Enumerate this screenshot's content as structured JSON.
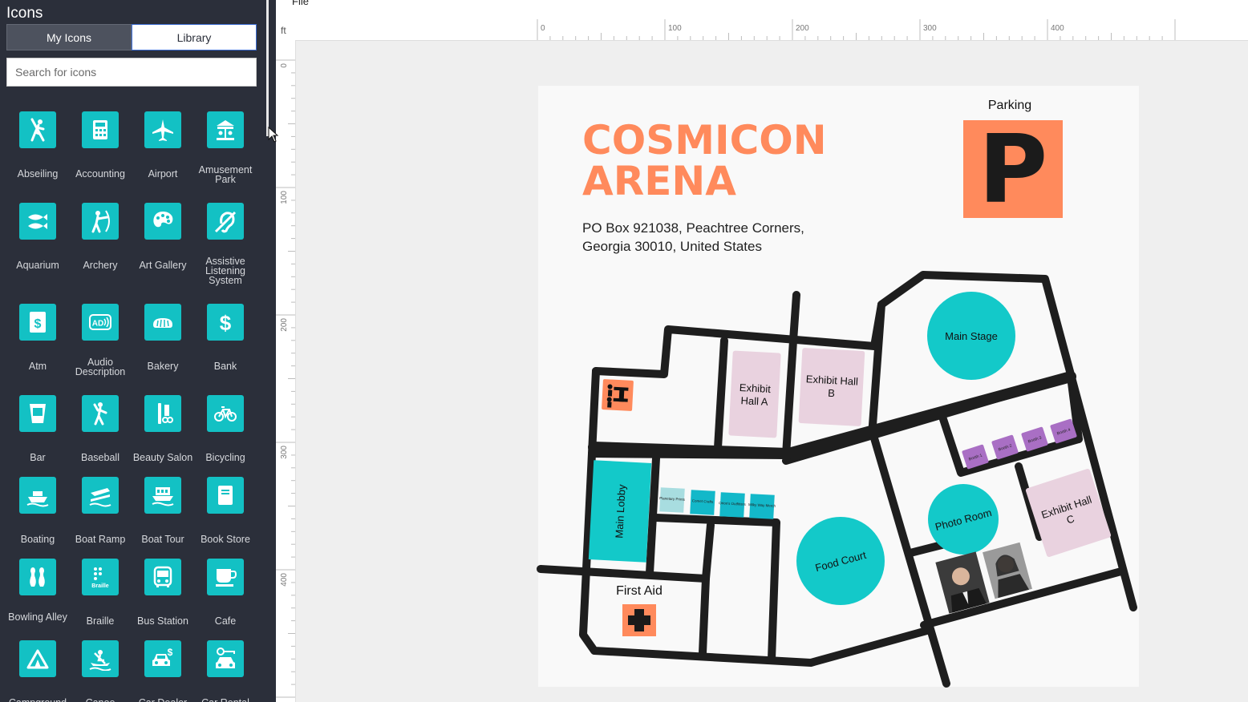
{
  "sidebar": {
    "title": "Icons",
    "tabs": {
      "my_icons": "My Icons",
      "library": "Library"
    },
    "search_placeholder": "Search for icons",
    "icons": [
      {
        "label": "Abseiling",
        "icon": "abseiling-icon"
      },
      {
        "label": "Accounting",
        "icon": "accounting-icon"
      },
      {
        "label": "Airport",
        "icon": "airport-icon"
      },
      {
        "label": "Amusement Park",
        "icon": "amusement-park-icon"
      },
      {
        "label": "Aquarium",
        "icon": "aquarium-icon"
      },
      {
        "label": "Archery",
        "icon": "archery-icon"
      },
      {
        "label": "Art Gallery",
        "icon": "art-gallery-icon"
      },
      {
        "label": "Assistive Listening System",
        "icon": "assistive-listening-icon"
      },
      {
        "label": "Atm",
        "icon": "atm-icon"
      },
      {
        "label": "Audio Description",
        "icon": "audio-description-icon"
      },
      {
        "label": "Bakery",
        "icon": "bakery-icon"
      },
      {
        "label": "Bank",
        "icon": "bank-icon"
      },
      {
        "label": "Bar",
        "icon": "bar-icon"
      },
      {
        "label": "Baseball",
        "icon": "baseball-icon"
      },
      {
        "label": "Beauty Salon",
        "icon": "beauty-salon-icon"
      },
      {
        "label": "Bicycling",
        "icon": "bicycling-icon"
      },
      {
        "label": "Boating",
        "icon": "boating-icon"
      },
      {
        "label": "Boat Ramp",
        "icon": "boat-ramp-icon"
      },
      {
        "label": "Boat Tour",
        "icon": "boat-tour-icon"
      },
      {
        "label": "Book Store",
        "icon": "book-store-icon"
      },
      {
        "label": "Bowling Alley",
        "icon": "bowling-alley-icon"
      },
      {
        "label": "Braille",
        "icon": "braille-icon"
      },
      {
        "label": "Bus Station",
        "icon": "bus-station-icon"
      },
      {
        "label": "Cafe",
        "icon": "cafe-icon"
      },
      {
        "label": "Campground",
        "icon": "campground-icon"
      },
      {
        "label": "Canoe",
        "icon": "canoe-icon"
      },
      {
        "label": "Car Dealer",
        "icon": "car-dealer-icon"
      },
      {
        "label": "Car Rental",
        "icon": "car-rental-icon"
      }
    ],
    "braille_text": "Braille",
    "ad_text": "AD"
  },
  "menu": {
    "file": "File"
  },
  "rulers": {
    "unit": "ft",
    "top_ticks": [
      "0",
      "100",
      "200",
      "300",
      "400"
    ],
    "left_ticks": [
      "0",
      "100",
      "200",
      "300",
      "400"
    ]
  },
  "map": {
    "title": "COSMICON ARENA",
    "address": "PO Box 921038, Peachtree Corners, Georgia 30010, United States",
    "parking_label": "Parking",
    "parking_letter": "P",
    "first_aid_label": "First Aid",
    "rooms": {
      "exhibit_hall_a": "Exhibit Hall A",
      "exhibit_hall_b": "Exhibit Hall B",
      "exhibit_hall_c": "Exhibit Hall C",
      "main_stage": "Main Stage",
      "main_lobby": "Main Lobby",
      "food_court": "Food Court",
      "photo_room": "Photo Room"
    },
    "booths": [
      "Booth 1",
      "Booth 2",
      "Booth 3",
      "Booth 4"
    ],
    "vendors": [
      "Planetary Prints",
      "Comet Crafts",
      "Orion's Outfitters",
      "Milky Way Merch"
    ],
    "colors": {
      "teal": "#13c9c9",
      "orange": "#ff8a5c",
      "pink": "#e9d2df",
      "purple": "#a96fc4",
      "dark": "#1e1e1e"
    }
  }
}
